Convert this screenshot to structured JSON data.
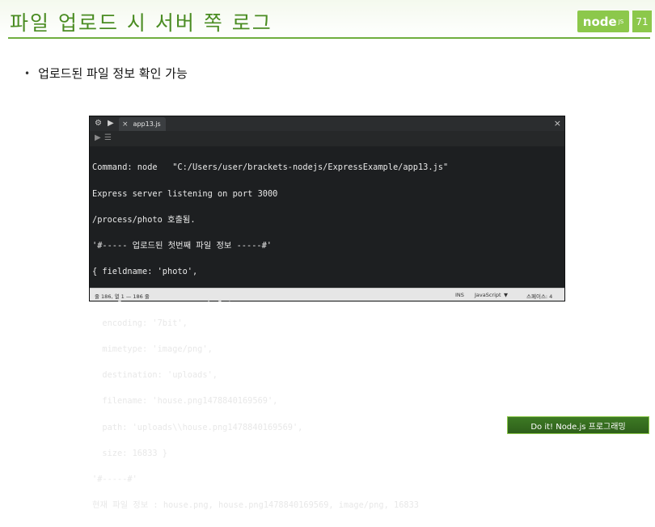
{
  "slide": {
    "title": "파일 업로드 시 서버 쪽 로그",
    "page_number": "71",
    "logo": "node",
    "logo_sub": "JS",
    "bullet": "업로드된 파일 정보 확인 가능",
    "footer": "Do it! Node.js 프로그래밍"
  },
  "editor": {
    "tab_label": "app13.js",
    "tab_close": "×",
    "window_close": "×",
    "console_lines": [
      "Command: node   \"C:/Users/user/brackets-nodejs/ExpressExample/app13.js\"",
      "Express server listening on port 3000",
      "/process/photo 호출됨.",
      "'#----- 업로드된 첫번째 파일 정보 -----#'",
      "{ fieldname: 'photo',",
      "  originalname: 'house.png',",
      "  encoding: '7bit',",
      "  mimetype: 'image/png',",
      "  destination: 'uploads',",
      "  filename: 'house.png1478840169569',",
      "  path: 'uploads\\\\house.png1478840169569',",
      "  size: 16833 }",
      "'#-----#'",
      "현재 파일 정보 : house.png, house.png1478840169569, image/png, 16833"
    ],
    "status": {
      "position": "줄 186, 열 1 — 186 줄",
      "ins": "INS",
      "language": "JavaScript",
      "language_arrow": "▼",
      "spaces": "스페이스: 4"
    }
  },
  "icons": {
    "tb_settings": "settings-icon",
    "tb_play": "play-icon",
    "tab_file": "file-icon",
    "tb_menu": "menu-icon"
  }
}
